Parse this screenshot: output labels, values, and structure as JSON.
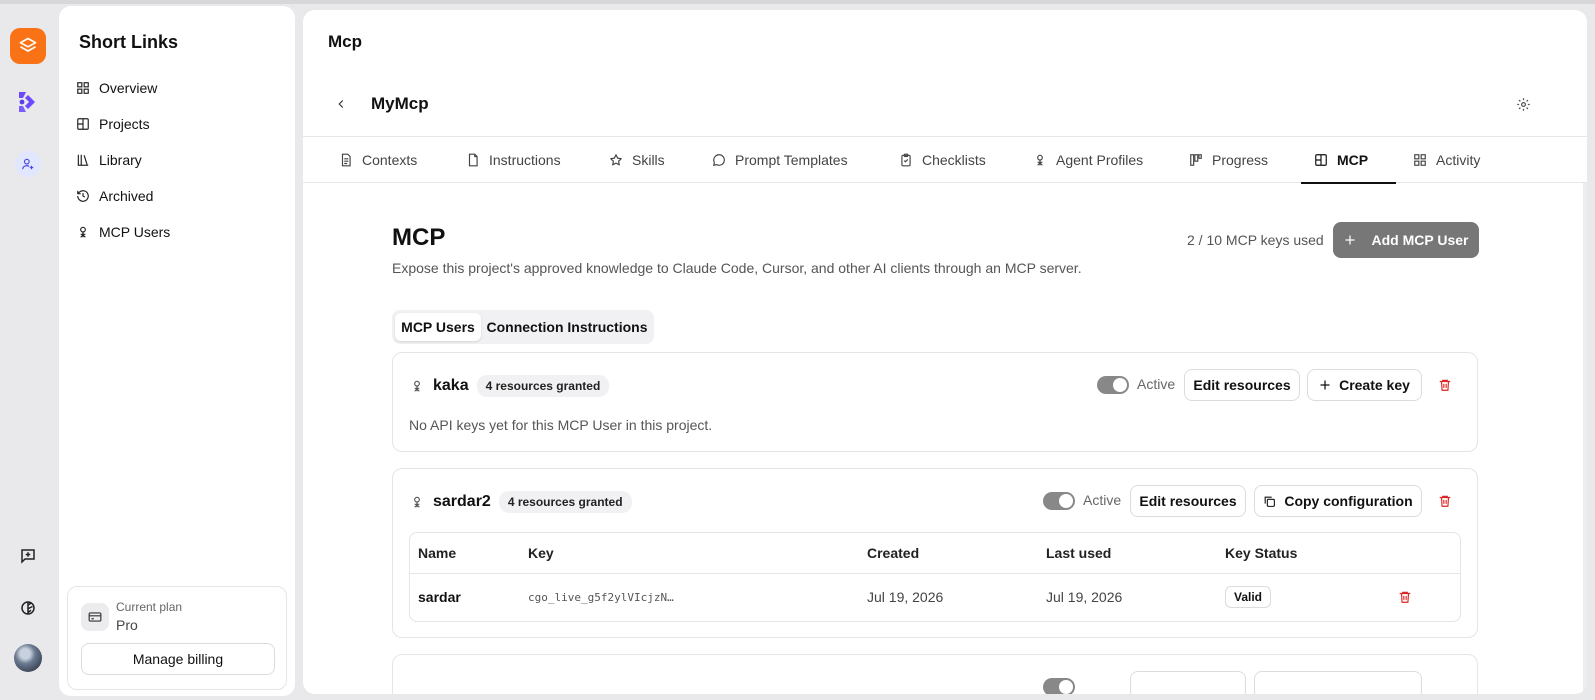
{
  "sidebar": {
    "title": "Short Links",
    "items": [
      {
        "label": "Overview",
        "icon": "grid-icon"
      },
      {
        "label": "Projects",
        "icon": "projects-icon"
      },
      {
        "label": "Library",
        "icon": "library-icon"
      },
      {
        "label": "Archived",
        "icon": "history-icon"
      },
      {
        "label": "MCP Users",
        "icon": "mcp-user-icon"
      }
    ],
    "plan": {
      "label": "Current plan",
      "name": "Pro",
      "billing_button": "Manage billing"
    }
  },
  "main": {
    "title": "Mcp",
    "project_title": "MyMcp",
    "tabs": [
      {
        "label": "Contexts",
        "icon": "document-icon"
      },
      {
        "label": "Instructions",
        "icon": "file-icon"
      },
      {
        "label": "Skills",
        "icon": "star-icon"
      },
      {
        "label": "Prompt Templates",
        "icon": "chat-icon"
      },
      {
        "label": "Checklists",
        "icon": "clipboard-icon"
      },
      {
        "label": "Agent Profiles",
        "icon": "agent-icon"
      },
      {
        "label": "Progress",
        "icon": "kanban-icon"
      },
      {
        "label": "MCP",
        "icon": "mcp-icon",
        "active": true
      },
      {
        "label": "Activity",
        "icon": "activity-icon"
      }
    ]
  },
  "mcp": {
    "heading": "MCP",
    "description": "Expose this project's approved knowledge to Claude Code, Cursor, and other AI clients through an MCP server.",
    "keys_used": "2 / 10 MCP keys used",
    "add_button": "Add MCP User",
    "segments": [
      "MCP Users",
      "Connection Instructions"
    ],
    "active_segment": "MCP Users"
  },
  "users": [
    {
      "name": "kaka",
      "badge": "4 resources granted",
      "status_label": "Active",
      "edit_button": "Edit resources",
      "action_button": "Create key",
      "empty_message": "No API keys yet for this MCP User in this project."
    },
    {
      "name": "sardar2",
      "badge": "4 resources granted",
      "status_label": "Active",
      "edit_button": "Edit resources",
      "action_button": "Copy configuration",
      "table": {
        "columns": [
          "Name",
          "Key",
          "Created",
          "Last used",
          "Key Status"
        ],
        "rows": [
          {
            "name": "sardar",
            "key": "cgo_live_g5f2ylVIcjzN…",
            "created": "Jul 19, 2026",
            "last_used": "Jul 19, 2026",
            "status": "Valid"
          }
        ]
      }
    }
  ],
  "colors": {
    "brand_orange": "#f97316",
    "accent_purple": "#6d4aff",
    "delete_red": "#dc2626",
    "primary_button": "#777777"
  }
}
